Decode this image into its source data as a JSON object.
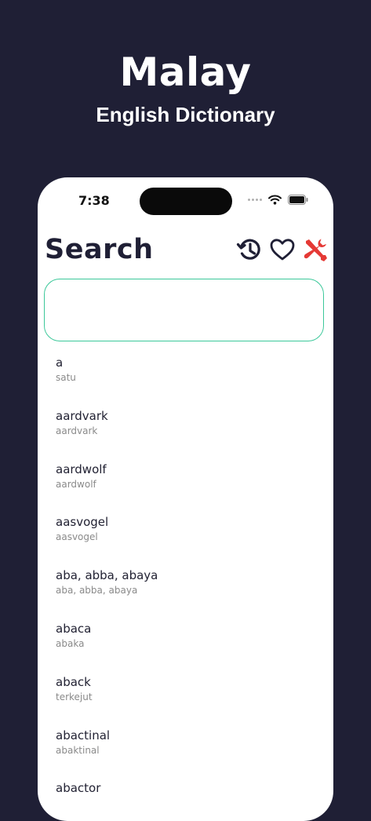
{
  "promo": {
    "title": "Malay",
    "subtitle": "English Dictionary"
  },
  "status_bar": {
    "time": "7:38"
  },
  "header": {
    "title": "Search",
    "actions": [
      {
        "name": "history-icon",
        "color": "#1f1f35"
      },
      {
        "name": "heart-icon",
        "color": "#1f1f35"
      },
      {
        "name": "tools-icon",
        "color": "#e53935"
      }
    ]
  },
  "search": {
    "value": "",
    "placeholder": ""
  },
  "colors": {
    "background": "#1f1f35",
    "accent": "#3cc89a",
    "tools": "#e53935"
  },
  "words": [
    {
      "term": "a",
      "translation": "satu"
    },
    {
      "term": "aardvark",
      "translation": "aardvark"
    },
    {
      "term": "aardwolf",
      "translation": "aardwolf"
    },
    {
      "term": "aasvogel",
      "translation": "aasvogel"
    },
    {
      "term": "aba, abba, abaya",
      "translation": "aba, abba, abaya"
    },
    {
      "term": "abaca",
      "translation": "abaka"
    },
    {
      "term": "aback",
      "translation": "terkejut"
    },
    {
      "term": "abactinal",
      "translation": "abaktinal"
    },
    {
      "term": "abactor",
      "translation": ""
    }
  ]
}
